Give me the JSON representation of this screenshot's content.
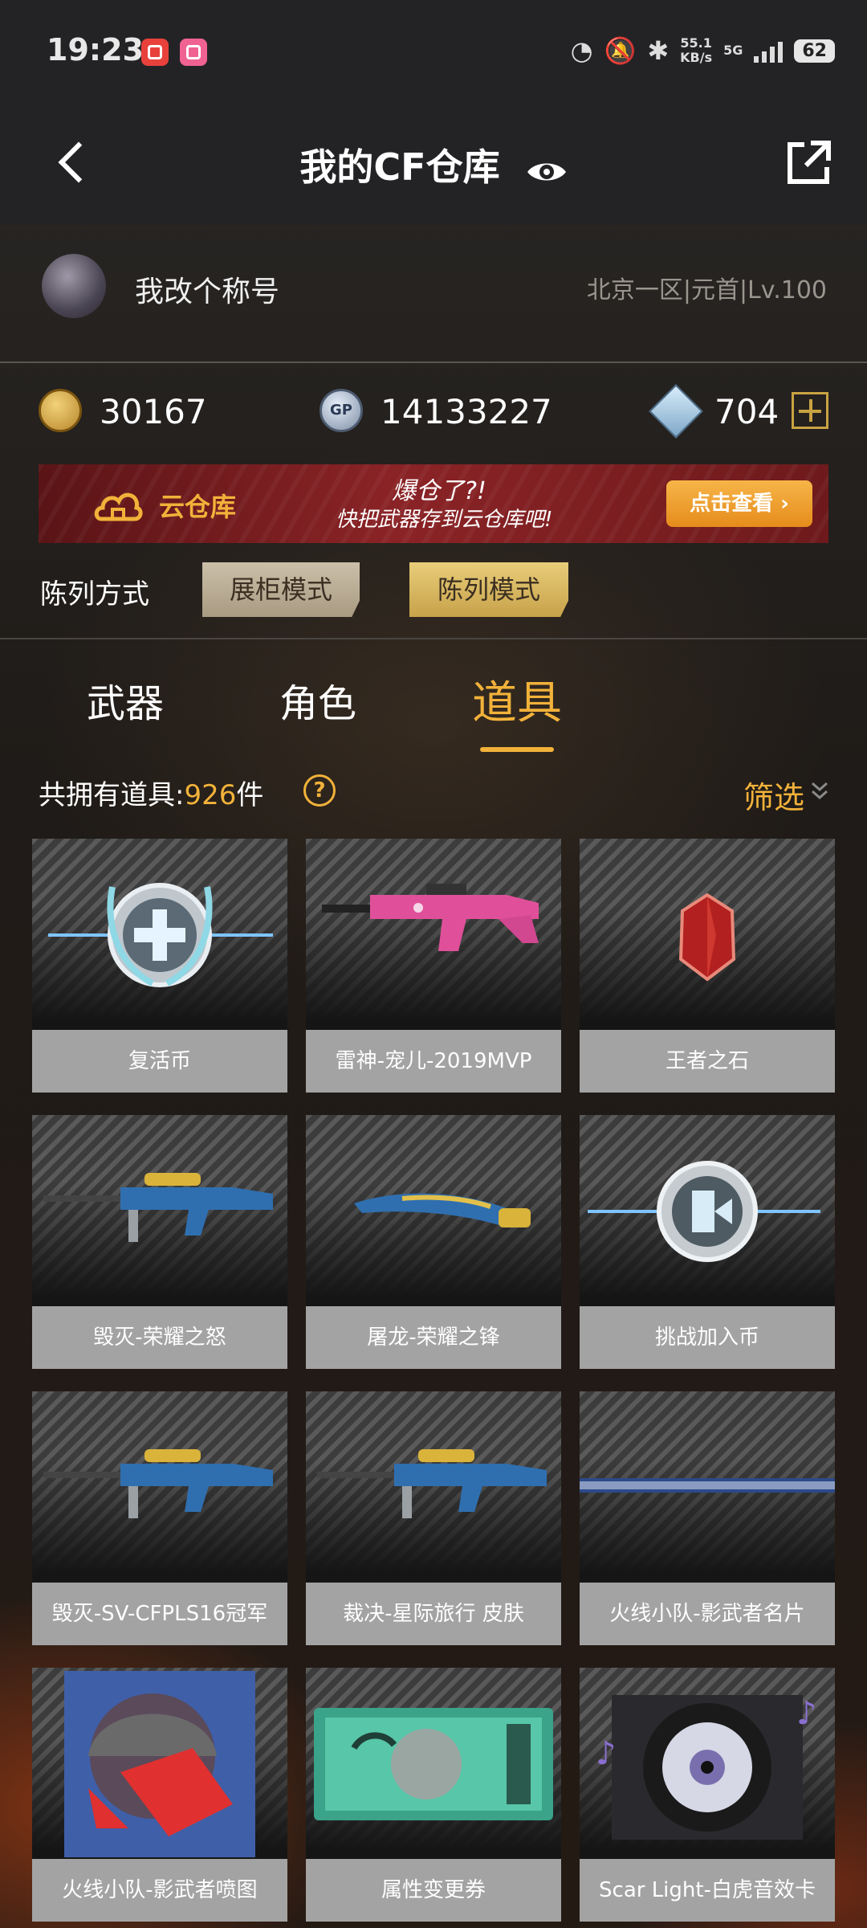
{
  "status_bar": {
    "time": "19:23",
    "net_speed": "55.1",
    "net_unit": "KB/s",
    "network": "5G",
    "battery": "62"
  },
  "nav": {
    "title": "我的CF仓库"
  },
  "profile": {
    "nickname": "我改个称号",
    "server_info": "北京一区|元首|Lv.100"
  },
  "currency": {
    "cf_points": "30167",
    "gp": "14133227",
    "gp_icon_text": "GP",
    "diamonds": "704"
  },
  "banner": {
    "title": "云仓库",
    "line1": "爆仓了?!",
    "line2": "快把武器存到云仓库吧!",
    "button": "点击查看 ›"
  },
  "display_mode": {
    "label": "陈列方式",
    "options": [
      "展柜模式",
      "陈列模式"
    ],
    "selected": "陈列模式"
  },
  "tabs": [
    {
      "label": "武器"
    },
    {
      "label": "角色"
    },
    {
      "label": "道具"
    }
  ],
  "active_tab": "道具",
  "count": {
    "prefix": "共拥有道具:",
    "number": "926",
    "suffix": "件",
    "help": "?"
  },
  "filter": {
    "label": "筛选"
  },
  "items": [
    {
      "label": "复活币",
      "icon": "revive-coin-icon"
    },
    {
      "label": "雷神-宠儿-2019MVP",
      "icon": "pink-rifle-icon"
    },
    {
      "label": "王者之石",
      "icon": "red-gem-icon"
    },
    {
      "label": "毁灭-荣耀之怒",
      "icon": "sniper-rifle-icon"
    },
    {
      "label": "屠龙-荣耀之锋",
      "icon": "blade-icon"
    },
    {
      "label": "挑战加入币",
      "icon": "challenge-coin-icon"
    },
    {
      "label": "毁灭-SV-CFPLS16冠军",
      "icon": "sniper-rifle-icon"
    },
    {
      "label": "裁决-星际旅行 皮肤",
      "icon": "sniper-rifle-icon"
    },
    {
      "label": "火线小队-影武者名片",
      "icon": "name-card-icon"
    },
    {
      "label": "火线小队-影武者喷图",
      "icon": "spray-icon"
    },
    {
      "label": "属性变更券",
      "icon": "ticket-icon"
    },
    {
      "label": "Scar Light-白虎音效卡",
      "icon": "music-disc-icon"
    }
  ],
  "colors": {
    "accent": "#f2b23a",
    "bar": "#232326",
    "label_bg": "#a3a3a3"
  }
}
